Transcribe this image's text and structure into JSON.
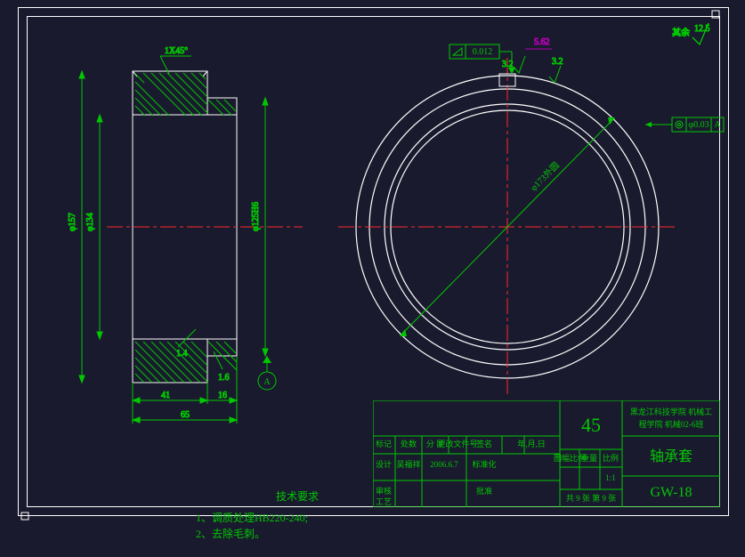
{
  "chamfer_label": "1X45°",
  "dims": {
    "d_outer": "φ157",
    "d_mid": "φ134",
    "d_bore": "φ125H6",
    "len_total": "65",
    "len_main": "41",
    "len_step": "16",
    "small1": "1.4",
    "small2": "1.6"
  },
  "gdt": {
    "flatness_val": "0.012",
    "conc_val": "φ0.03",
    "conc_datum": "A",
    "datum_a": "A"
  },
  "surface": {
    "sf1": "3.2",
    "sf2": "3.2",
    "sf_general": "12.5",
    "sf_general_prefix": "其余"
  },
  "diameter_arrow": "φ173外圆",
  "leader_dim": "5.62",
  "tech_req": {
    "title": "技术要求",
    "line1": "1、调质处理HB220-240;",
    "line2": "2、去除毛刺。"
  },
  "title_block": {
    "material": "45",
    "school1": "黑龙江科技学院 机械工",
    "school2": "程学院 机械02-6班",
    "part_name": "轴承套",
    "drawing_no": "GW-18",
    "hdr": {
      "c1": "标记",
      "c2": "处数",
      "c3": "分 区",
      "c4": "更改文件号",
      "c5": "签名",
      "c6": "年,月,日"
    },
    "design_label": "设计",
    "designer": "吴福祥",
    "date": "2006.6.7",
    "std_label": "标准化",
    "scale_label": "图幅比例",
    "weight_label": "重量",
    "scale_unit": "比例",
    "scale": "1:1",
    "review_label": "审核",
    "process_label": "工艺",
    "approve_label": "批准",
    "sheet": "共 9 张   第 9 张"
  }
}
